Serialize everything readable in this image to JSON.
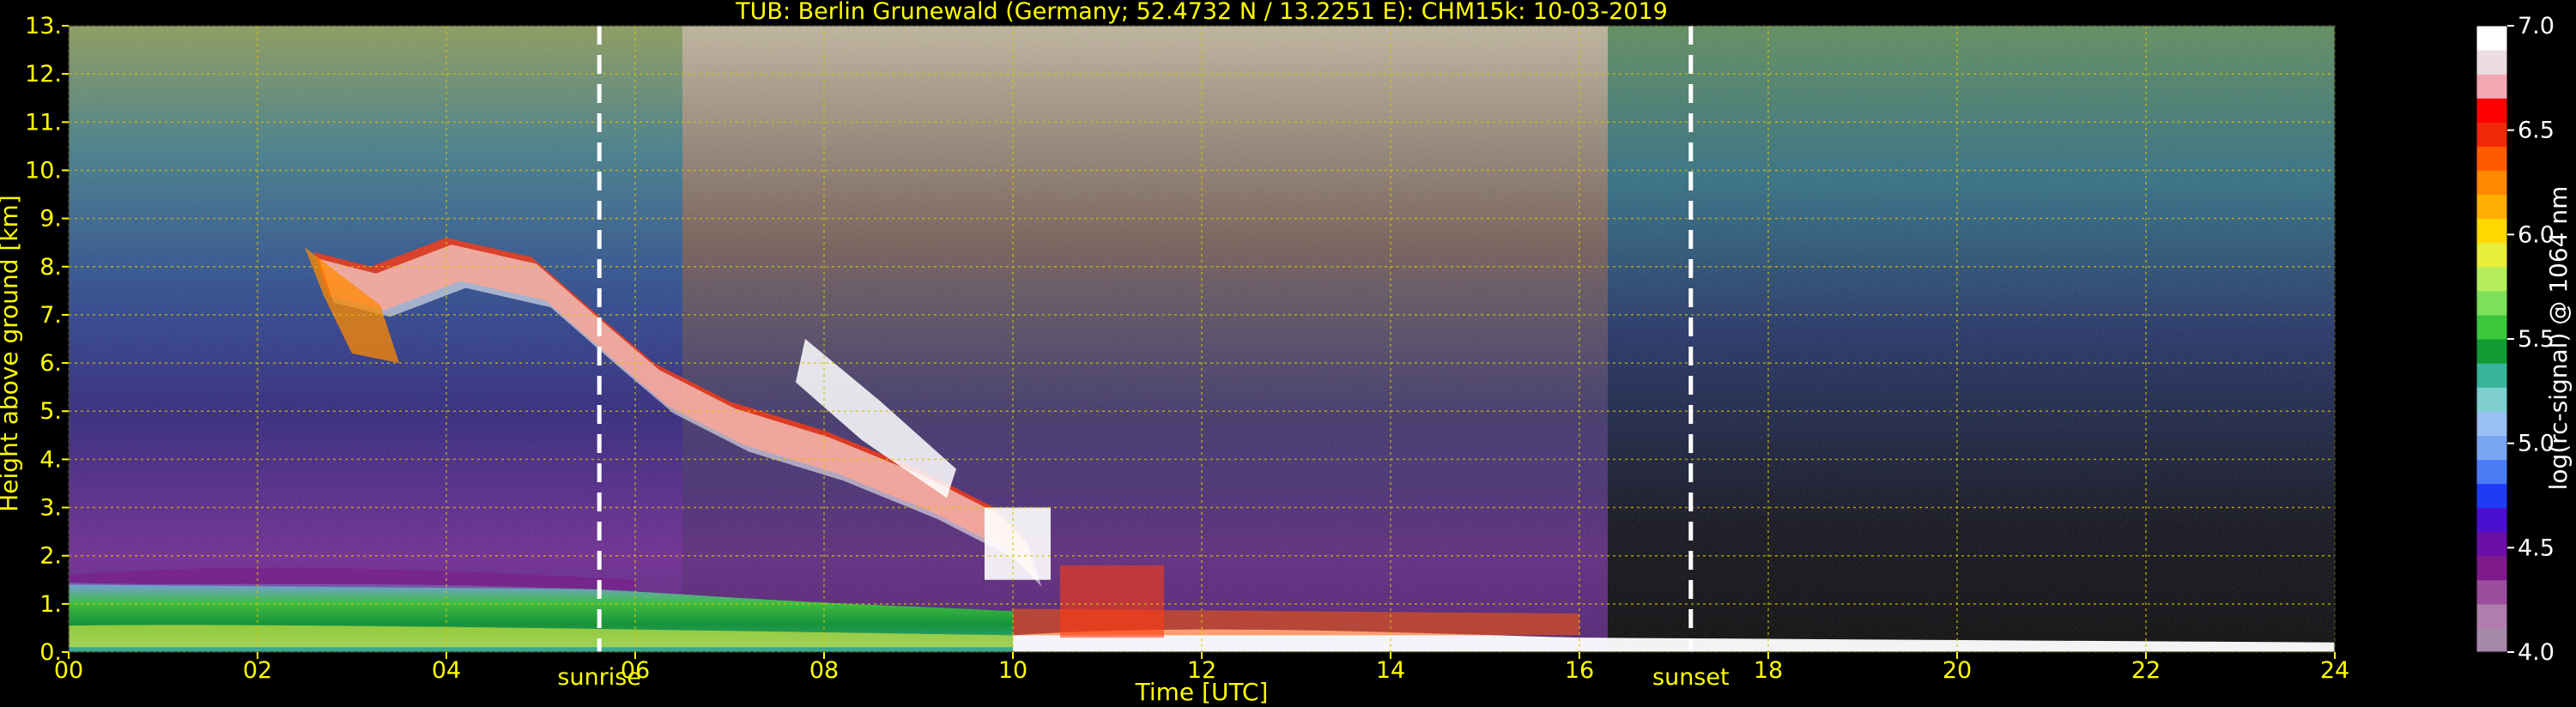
{
  "chart_data": {
    "type": "heatmap",
    "title": "TUB: Berlin Grunewald (Germany; 52.4732 N / 13.2251 E):    CHM15k: 10-03-2019",
    "xlabel": "Time [UTC]",
    "ylabel": "Height above ground [km]",
    "colorbar_label": "log(rc-signal) @ 1064 nm",
    "x_ticks": [
      "00",
      "02",
      "04",
      "06",
      "08",
      "10",
      "12",
      "14",
      "16",
      "18",
      "20",
      "22",
      "24"
    ],
    "x_tick_values": [
      0,
      2,
      4,
      6,
      8,
      10,
      12,
      14,
      16,
      18,
      20,
      22,
      24
    ],
    "y_ticks": [
      "0.",
      "1.",
      "2.",
      "3.",
      "4.",
      "5.",
      "6.",
      "7.",
      "8.",
      "9.",
      "10.",
      "11.",
      "12.",
      "13."
    ],
    "y_tick_values": [
      0,
      1,
      2,
      3,
      4,
      5,
      6,
      7,
      8,
      9,
      10,
      11,
      12,
      13
    ],
    "xlim": [
      0,
      24
    ],
    "ylim": [
      0,
      13
    ],
    "grid": true,
    "colorbar_ticks": [
      "4.0",
      "4.5",
      "5.0",
      "5.5",
      "6.0",
      "6.5",
      "7.0"
    ],
    "colorbar_tick_values": [
      4.0,
      4.5,
      5.0,
      5.5,
      6.0,
      6.5,
      7.0
    ],
    "colorbar_range": [
      4.0,
      7.0
    ],
    "colorscale": [
      "#a58aa8",
      "#b07dae",
      "#9a4e9d",
      "#7e1a8a",
      "#6a10a8",
      "#4b0fd0",
      "#1e3cf5",
      "#4a7cf5",
      "#7aa5f0",
      "#9bc0f2",
      "#7fcfcf",
      "#37b59a",
      "#119b34",
      "#3cc83c",
      "#7de05a",
      "#b4ee5e",
      "#e8ee3c",
      "#ffd800",
      "#ffb000",
      "#ff8a00",
      "#ff5a00",
      "#f02a0a",
      "#ff0000",
      "#f3a9b0",
      "#ecdde0",
      "#ffffff"
    ],
    "annotations": [
      {
        "text": "sunrise",
        "x": 5.62
      },
      {
        "text": "sunset",
        "x": 17.18
      }
    ],
    "colors": {
      "axis_text": "#ffff00",
      "grid": "#d6c400",
      "background": "#000000",
      "marker_line": "#ffffff"
    }
  }
}
